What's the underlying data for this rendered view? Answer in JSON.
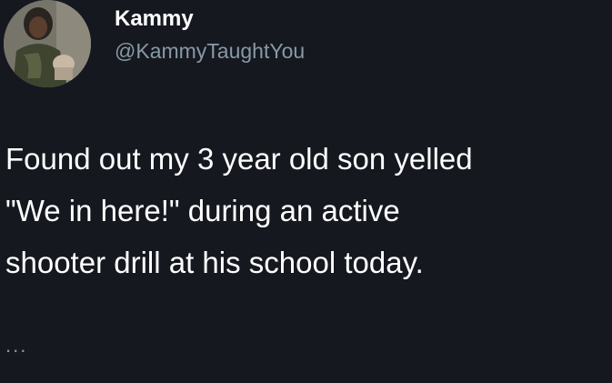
{
  "tweet": {
    "author_name": "Kammy",
    "author_handle": "@KammyTaughtYou",
    "text_lines": [
      "Found out my 3 year old son yelled",
      "\"We in here!\" during an active",
      "shooter drill at his school today."
    ],
    "more_indicator": "...",
    "avatar_icon": "avatar-photo-icon"
  },
  "colors": {
    "background": "#15181f",
    "primary_text": "#ffffff",
    "secondary_text": "#8899a6"
  }
}
